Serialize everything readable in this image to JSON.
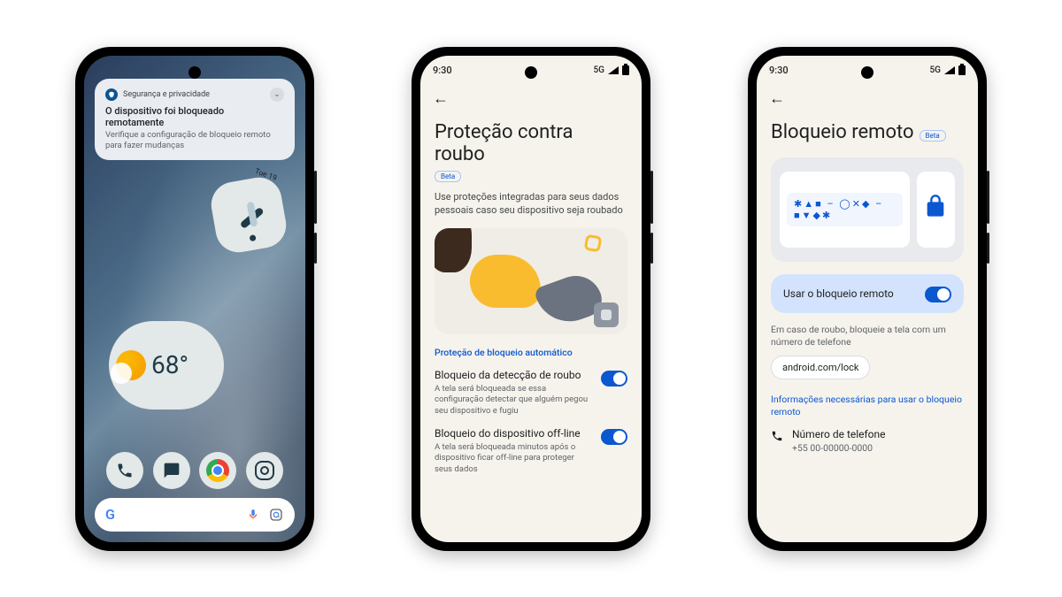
{
  "phone1": {
    "notif_category": "Segurança e privacidade",
    "notif_title": "O dispositivo foi bloqueado remotamente",
    "notif_sub": "Verifique a configuração de bloqueio remoto para fazer mudanças",
    "clock_date": "Tue 19",
    "temperature": "68°",
    "search_letter": "G",
    "dock": {
      "phone": "phone-icon",
      "message": "message-icon",
      "chrome": "chrome-icon",
      "camera": "camera-icon"
    }
  },
  "phone2": {
    "time": "9:30",
    "network": "5G",
    "title": "Proteção contra roubo",
    "beta": "Beta",
    "subtitle": "Use proteções integradas para seus dados pessoais caso seu dispositivo seja roubado",
    "section_label": "Proteção de bloqueio automático",
    "setting1_title": "Bloqueio da detecção de roubo",
    "setting1_desc": "A tela será bloqueada se essa configuração detectar que alguém pegou seu dispositivo e fugiu",
    "setting2_title": "Bloqueio do dispositivo off-line",
    "setting2_desc": "A tela será bloqueada minutos após o dispositivo ficar off-line para proteger seus dados"
  },
  "phone3": {
    "time": "9:30",
    "network": "5G",
    "title": "Bloqueio remoto",
    "beta": "Beta",
    "symbols": "✱▲■ – ◯✕◆ – ■▼◆✱",
    "use_lock_label": "Usar o bloqueio remoto",
    "help_text": "Em caso de roubo, bloqueie a tela com um número de telefone",
    "url": "android.com/lock",
    "info_label": "Informações necessárias para usar o bloqueio remoto",
    "phone_label": "Número de telefone",
    "phone_value": "+55 00-00000-0000"
  }
}
